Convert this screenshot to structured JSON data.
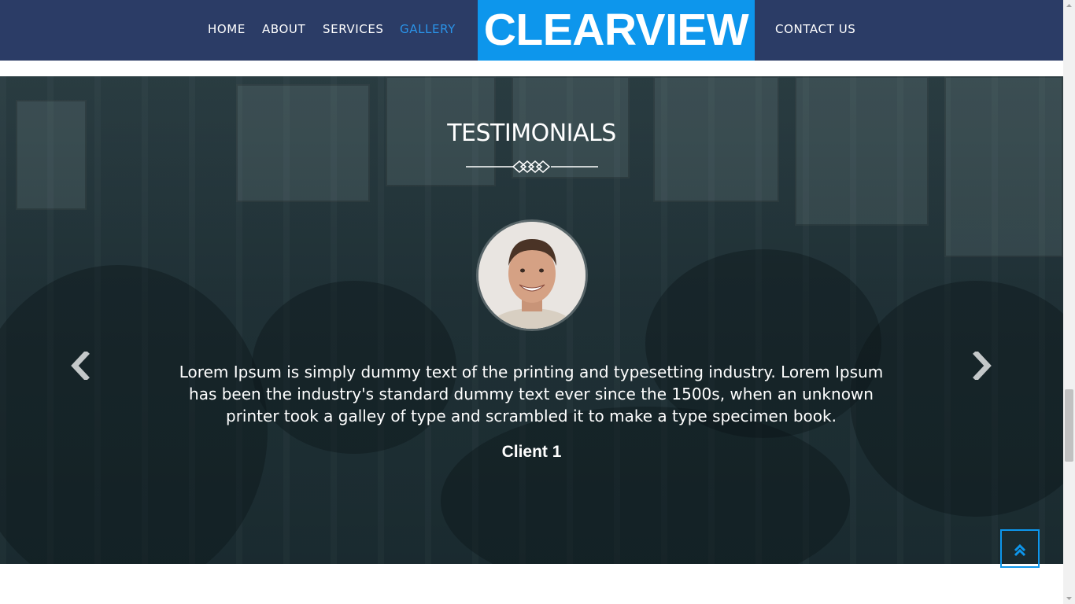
{
  "nav": {
    "items": [
      {
        "label": "HOME",
        "active": false
      },
      {
        "label": "ABOUT",
        "active": false
      },
      {
        "label": "SERVICES",
        "active": false
      },
      {
        "label": "GALLERY",
        "active": true
      }
    ],
    "logo": "CLEARVIEW",
    "contact": "CONTACT US"
  },
  "testimonials": {
    "title": "TESTIMONIALS",
    "quote": "Lorem Ipsum is simply dummy text of the printing and typesetting industry. Lorem Ipsum has been the industry's standard dummy text ever since the 1500s, when an unknown printer took a galley of type and scrambled it to make a type specimen book.",
    "client": "Client 1",
    "prev_icon": "chevron-left-icon",
    "next_icon": "chevron-right-icon"
  },
  "scroll_top_icon": "double-chevron-up-icon",
  "colors": {
    "header_bg": "#2b3c66",
    "accent": "#0d96ec",
    "active_nav": "#2a93e8",
    "text": "#ffffff"
  }
}
